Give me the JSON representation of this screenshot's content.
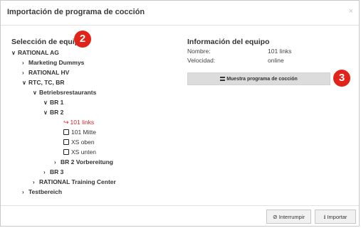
{
  "dialog": {
    "title": "Importación de programa de cocción",
    "close_glyph": "×"
  },
  "left": {
    "heading": "Selección de equipo",
    "badge": "2"
  },
  "tree": [
    {
      "label": "RATIONAL AG",
      "state": "expanded"
    },
    {
      "label": "Marketing Dummys",
      "state": "collapsed"
    },
    {
      "label": "RATIONAL HV",
      "state": "collapsed"
    },
    {
      "label": "RTC, TC, BR",
      "state": "expanded"
    },
    {
      "label": "Betriebsrestaurants",
      "state": "expanded"
    },
    {
      "label": "BR 1",
      "state": "expanded"
    },
    {
      "label": "BR 2",
      "state": "expanded"
    },
    {
      "label": "101 links",
      "state": "selected"
    },
    {
      "label": "101 Mitte",
      "state": "leaf"
    },
    {
      "label": "XS oben",
      "state": "leaf"
    },
    {
      "label": "XS unten",
      "state": "leaf"
    },
    {
      "label": "BR 2 Vorbereitung",
      "state": "collapsed"
    },
    {
      "label": "BR 3",
      "state": "collapsed"
    },
    {
      "label": "RATIONAL Training Center",
      "state": "collapsed"
    },
    {
      "label": "Testbereich",
      "state": "collapsed"
    }
  ],
  "info": {
    "heading": "Información del equipo",
    "name_label": "Nombre:",
    "name_value": "101 links",
    "speed_label": "Velocidad:",
    "speed_value": "online",
    "show_button": "Muestra programa de cocción",
    "badge": "3"
  },
  "footer": {
    "cancel": "Interrumpir",
    "import": "Importar"
  },
  "colors": {
    "accent_red": "#e2231a",
    "selected_text": "#d4262b"
  },
  "icons": {
    "expanded": "chevron-down-icon",
    "collapsed": "chevron-right-icon",
    "selected": "sign-in-icon",
    "leaf": "square-icon",
    "cancel": "ban-icon",
    "import": "import-icon",
    "show": "list-icon"
  }
}
